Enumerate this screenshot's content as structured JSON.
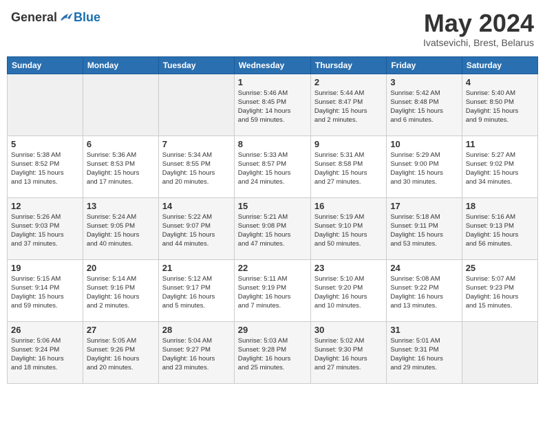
{
  "header": {
    "logo_general": "General",
    "logo_blue": "Blue",
    "month_title": "May 2024",
    "subtitle": "Ivatsevichi, Brest, Belarus"
  },
  "days_of_week": [
    "Sunday",
    "Monday",
    "Tuesday",
    "Wednesday",
    "Thursday",
    "Friday",
    "Saturday"
  ],
  "weeks": [
    [
      {
        "day": "",
        "info": ""
      },
      {
        "day": "",
        "info": ""
      },
      {
        "day": "",
        "info": ""
      },
      {
        "day": "1",
        "info": "Sunrise: 5:46 AM\nSunset: 8:45 PM\nDaylight: 14 hours\nand 59 minutes."
      },
      {
        "day": "2",
        "info": "Sunrise: 5:44 AM\nSunset: 8:47 PM\nDaylight: 15 hours\nand 2 minutes."
      },
      {
        "day": "3",
        "info": "Sunrise: 5:42 AM\nSunset: 8:48 PM\nDaylight: 15 hours\nand 6 minutes."
      },
      {
        "day": "4",
        "info": "Sunrise: 5:40 AM\nSunset: 8:50 PM\nDaylight: 15 hours\nand 9 minutes."
      }
    ],
    [
      {
        "day": "5",
        "info": "Sunrise: 5:38 AM\nSunset: 8:52 PM\nDaylight: 15 hours\nand 13 minutes."
      },
      {
        "day": "6",
        "info": "Sunrise: 5:36 AM\nSunset: 8:53 PM\nDaylight: 15 hours\nand 17 minutes."
      },
      {
        "day": "7",
        "info": "Sunrise: 5:34 AM\nSunset: 8:55 PM\nDaylight: 15 hours\nand 20 minutes."
      },
      {
        "day": "8",
        "info": "Sunrise: 5:33 AM\nSunset: 8:57 PM\nDaylight: 15 hours\nand 24 minutes."
      },
      {
        "day": "9",
        "info": "Sunrise: 5:31 AM\nSunset: 8:58 PM\nDaylight: 15 hours\nand 27 minutes."
      },
      {
        "day": "10",
        "info": "Sunrise: 5:29 AM\nSunset: 9:00 PM\nDaylight: 15 hours\nand 30 minutes."
      },
      {
        "day": "11",
        "info": "Sunrise: 5:27 AM\nSunset: 9:02 PM\nDaylight: 15 hours\nand 34 minutes."
      }
    ],
    [
      {
        "day": "12",
        "info": "Sunrise: 5:26 AM\nSunset: 9:03 PM\nDaylight: 15 hours\nand 37 minutes."
      },
      {
        "day": "13",
        "info": "Sunrise: 5:24 AM\nSunset: 9:05 PM\nDaylight: 15 hours\nand 40 minutes."
      },
      {
        "day": "14",
        "info": "Sunrise: 5:22 AM\nSunset: 9:07 PM\nDaylight: 15 hours\nand 44 minutes."
      },
      {
        "day": "15",
        "info": "Sunrise: 5:21 AM\nSunset: 9:08 PM\nDaylight: 15 hours\nand 47 minutes."
      },
      {
        "day": "16",
        "info": "Sunrise: 5:19 AM\nSunset: 9:10 PM\nDaylight: 15 hours\nand 50 minutes."
      },
      {
        "day": "17",
        "info": "Sunrise: 5:18 AM\nSunset: 9:11 PM\nDaylight: 15 hours\nand 53 minutes."
      },
      {
        "day": "18",
        "info": "Sunrise: 5:16 AM\nSunset: 9:13 PM\nDaylight: 15 hours\nand 56 minutes."
      }
    ],
    [
      {
        "day": "19",
        "info": "Sunrise: 5:15 AM\nSunset: 9:14 PM\nDaylight: 15 hours\nand 59 minutes."
      },
      {
        "day": "20",
        "info": "Sunrise: 5:14 AM\nSunset: 9:16 PM\nDaylight: 16 hours\nand 2 minutes."
      },
      {
        "day": "21",
        "info": "Sunrise: 5:12 AM\nSunset: 9:17 PM\nDaylight: 16 hours\nand 5 minutes."
      },
      {
        "day": "22",
        "info": "Sunrise: 5:11 AM\nSunset: 9:19 PM\nDaylight: 16 hours\nand 7 minutes."
      },
      {
        "day": "23",
        "info": "Sunrise: 5:10 AM\nSunset: 9:20 PM\nDaylight: 16 hours\nand 10 minutes."
      },
      {
        "day": "24",
        "info": "Sunrise: 5:08 AM\nSunset: 9:22 PM\nDaylight: 16 hours\nand 13 minutes."
      },
      {
        "day": "25",
        "info": "Sunrise: 5:07 AM\nSunset: 9:23 PM\nDaylight: 16 hours\nand 15 minutes."
      }
    ],
    [
      {
        "day": "26",
        "info": "Sunrise: 5:06 AM\nSunset: 9:24 PM\nDaylight: 16 hours\nand 18 minutes."
      },
      {
        "day": "27",
        "info": "Sunrise: 5:05 AM\nSunset: 9:26 PM\nDaylight: 16 hours\nand 20 minutes."
      },
      {
        "day": "28",
        "info": "Sunrise: 5:04 AM\nSunset: 9:27 PM\nDaylight: 16 hours\nand 23 minutes."
      },
      {
        "day": "29",
        "info": "Sunrise: 5:03 AM\nSunset: 9:28 PM\nDaylight: 16 hours\nand 25 minutes."
      },
      {
        "day": "30",
        "info": "Sunrise: 5:02 AM\nSunset: 9:30 PM\nDaylight: 16 hours\nand 27 minutes."
      },
      {
        "day": "31",
        "info": "Sunrise: 5:01 AM\nSunset: 9:31 PM\nDaylight: 16 hours\nand 29 minutes."
      },
      {
        "day": "",
        "info": ""
      }
    ]
  ]
}
